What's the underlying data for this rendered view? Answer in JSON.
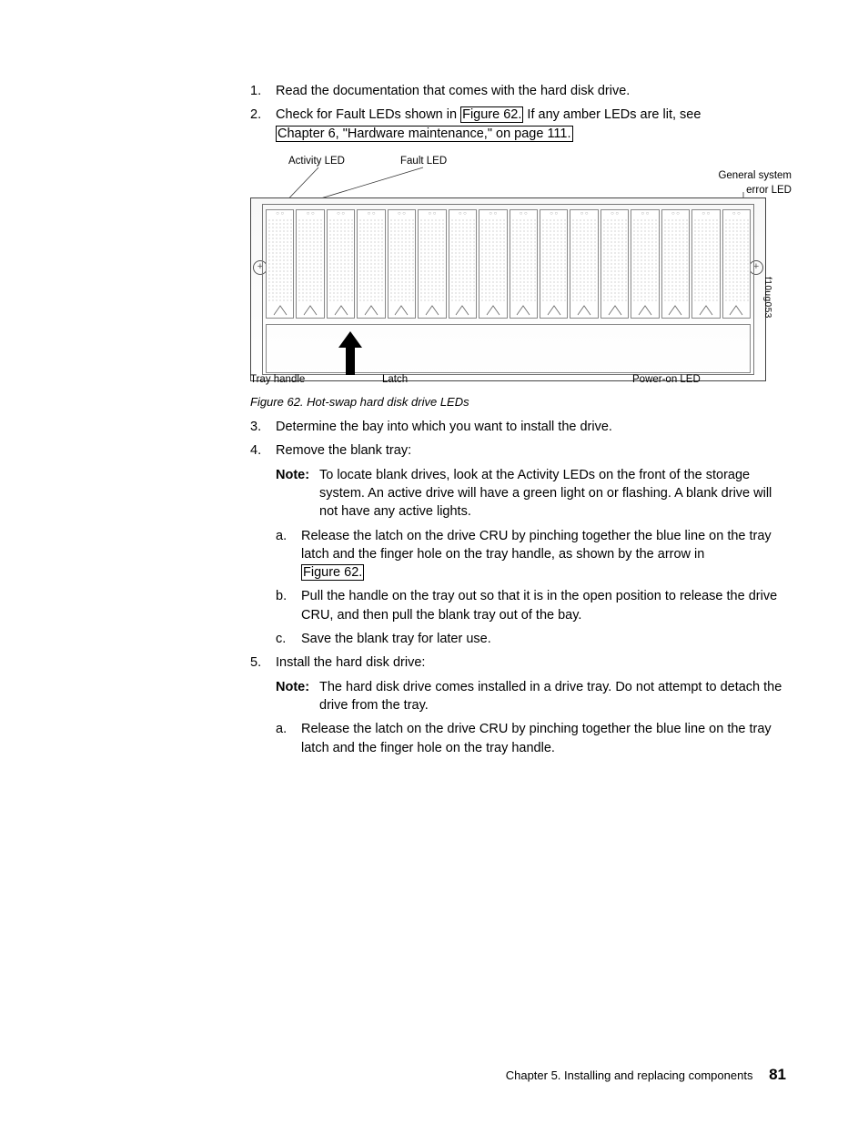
{
  "steps": {
    "s1": {
      "num": "1.",
      "text": "Read the documentation that comes with the hard disk drive."
    },
    "s2": {
      "num": "2.",
      "pre": "Check for Fault LEDs shown in ",
      "link1": "Figure 62.",
      "mid": " If any amber LEDs are lit, see ",
      "link2": "Chapter 6, \"Hardware maintenance,\" on page 111."
    },
    "s3": {
      "num": "3.",
      "text": "Determine the bay into which you want to install the drive."
    },
    "s4": {
      "num": "4.",
      "text": "Remove the blank tray:",
      "note_label": "Note:",
      "note_text": "To locate blank drives, look at the Activity LEDs on the front of the storage system. An active drive will have a green light on or flashing. A blank drive will not have any active lights.",
      "a": {
        "num": "a.",
        "pre": "Release the latch on the drive CRU by pinching together the blue line on the tray latch and the finger hole on the tray handle, as shown by the arrow in ",
        "link": "Figure 62."
      },
      "b": {
        "num": "b.",
        "text": "Pull the handle on the tray out so that it is in the open position to release the drive CRU, and then pull the blank tray out of the bay."
      },
      "c": {
        "num": "c.",
        "text": "Save the blank tray for later use."
      }
    },
    "s5": {
      "num": "5.",
      "text": "Install the hard disk drive:",
      "note_label": "Note:",
      "note_text": "The hard disk drive comes installed in a drive tray. Do not attempt to detach the drive from the tray.",
      "a": {
        "num": "a.",
        "text": "Release the latch on the drive CRU by pinching together the blue line on the tray latch and the finger hole on the tray handle."
      }
    }
  },
  "diagram": {
    "activity_led": "Activity LED",
    "fault_led": "Fault LED",
    "gen_error_1": "General system",
    "gen_error_2": "error LED",
    "tray_handle": "Tray handle",
    "latch": "Latch",
    "power_on": "Power-on LED",
    "side": "f10ug053"
  },
  "figure_caption": "Figure 62. Hot-swap hard disk drive LEDs",
  "footer": {
    "chapter": "Chapter 5. Installing and replacing components",
    "page": "81"
  }
}
